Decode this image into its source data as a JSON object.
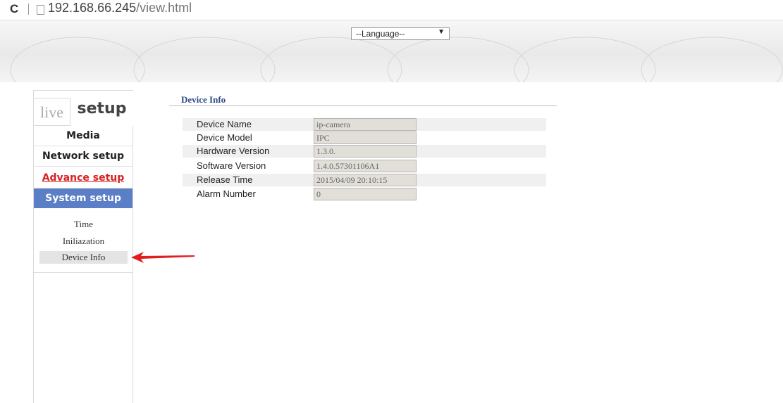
{
  "browser": {
    "url_host": "192.168.66.245",
    "url_path": "/view.html"
  },
  "header": {
    "language_select": {
      "selected": "--Language--"
    }
  },
  "sidebar": {
    "tabs": {
      "live": "live",
      "setup": "setup"
    },
    "nav": {
      "media": "Media",
      "network": "Network setup",
      "advance": "Advance setup",
      "system": "System setup"
    },
    "submenu": [
      {
        "label": "Time"
      },
      {
        "label": "Iniliazation"
      },
      {
        "label": "Device Info",
        "active": true
      }
    ]
  },
  "main": {
    "section_title": "Device Info",
    "fields": [
      {
        "label": "Device Name",
        "value": "ip-camera"
      },
      {
        "label": "Device Model",
        "value": "IPC"
      },
      {
        "label": "Hardware Version",
        "value": "1.3.0."
      },
      {
        "label": "Software Version",
        "value": "1.4.0.57301106A1"
      },
      {
        "label": "Release Time",
        "value": "2015/04/09 20:10:15"
      },
      {
        "label": "Alarm Number",
        "value": "0"
      }
    ]
  },
  "colors": {
    "system_setup_bg": "#5b7fc7",
    "advance_setup_text": "#d82222",
    "section_title": "#2a4a8a",
    "annotation_arrow": "#e02020"
  },
  "icons": {
    "reload": "reload-icon",
    "page": "page-icon",
    "dropdown": "chevron-down-icon",
    "annotation": "red-arrow-icon"
  }
}
